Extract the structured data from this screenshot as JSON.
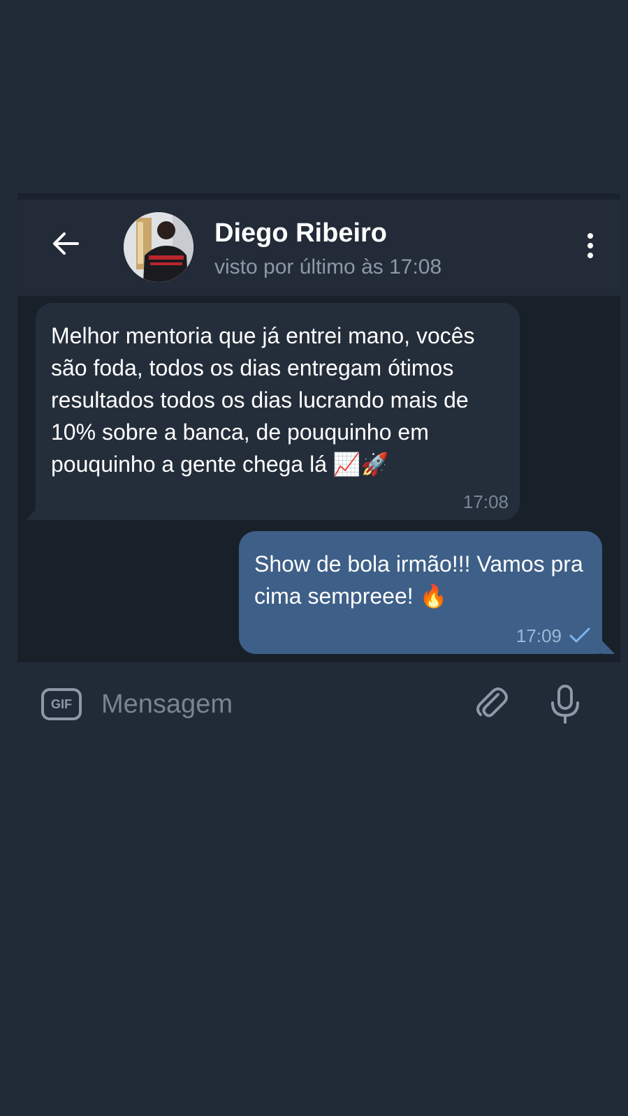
{
  "header": {
    "contact_name": "Diego Ribeiro",
    "last_seen": "visto por último às 17:08",
    "back_icon": "arrow-left-icon",
    "menu_icon": "more-vertical-icon"
  },
  "messages": [
    {
      "direction": "incoming",
      "text": "Melhor mentoria que já entrei mano, vocês são foda, todos os dias entregam ótimos resultados todos os dias lucrando mais de 10% sobre a banca, de pouquinho em pouquinho a gente chega lá 📈🚀",
      "time": "17:08"
    },
    {
      "direction": "outgoing",
      "text": "Show de bola irmão!!! Vamos pra cima sempreee! 🔥",
      "time": "17:09",
      "status": "sent"
    }
  ],
  "composer": {
    "gif_label": "GIF",
    "placeholder": "Mensagem",
    "attach_icon": "paperclip-icon",
    "mic_icon": "microphone-icon"
  },
  "colors": {
    "background": "#212b38",
    "chat_background": "#18202a",
    "incoming_bubble": "#242e3a",
    "outgoing_bubble": "#3e5f87",
    "check_mark": "#7fb4f0"
  }
}
